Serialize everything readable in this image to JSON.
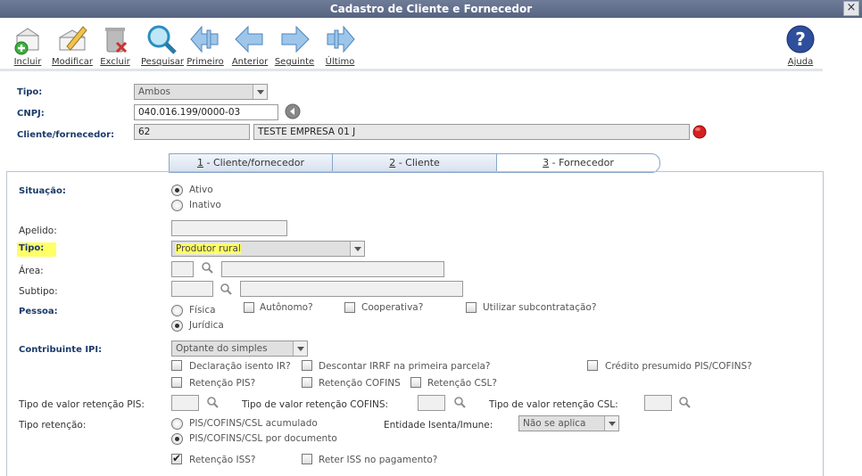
{
  "window": {
    "title": "Cadastro de Cliente e Fornecedor",
    "close": "×"
  },
  "toolbar": {
    "incluir": "Incluir",
    "modificar": "Modificar",
    "excluir": "Excluir",
    "pesquisar": "Pesquisar",
    "primeiro": "Primeiro",
    "anterior": "Anterior",
    "seguinte": "Seguinte",
    "ultimo": "Último",
    "ajuda": "Ajuda"
  },
  "header": {
    "tipo_label": "Tipo:",
    "tipo_value": "Ambos",
    "cnpj_label": "CNPJ:",
    "cnpj_value": "040.016.199/0000-03",
    "cliente_label": "Cliente/fornecedor:",
    "cliente_code": "62",
    "cliente_name": "TESTE EMPRESA 01 J"
  },
  "tabs": [
    {
      "num": "1",
      "label": " - Cliente/fornecedor"
    },
    {
      "num": "2",
      "label": " - Cliente"
    },
    {
      "num": "3",
      "label": " - Fornecedor"
    }
  ],
  "form": {
    "situacao_label": "Situação:",
    "situacao_ativo": "Ativo",
    "situacao_inativo": "Inativo",
    "apelido_label": "Apelido:",
    "tipo_label": "Tipo:",
    "tipo_value": "Produtor rural",
    "area_label": "Área:",
    "subtipo_label": "Subtipo:",
    "pessoa_label": "Pessoa:",
    "pessoa_fisica": "Física",
    "pessoa_juridica": "Jurídica",
    "autonomo": "Autônomo?",
    "cooperativa": "Cooperativa?",
    "subcontratacao": "Utilizar subcontratação?",
    "contribuinte_label": "Contribuinte IPI:",
    "contribuinte_value": "Optante do simples",
    "decl_isento": "Declaração isento IR?",
    "descontar_irrf": "Descontar IRRF na primeira parcela?",
    "credito_presumido": "Crédito presumido PIS/COFINS?",
    "retencao_pis": "Retenção PIS?",
    "retencao_cofins": "Retenção COFINS",
    "retencao_csl": "Retenção CSL?",
    "tipo_valor_pis": "Tipo de valor retenção PIS:",
    "tipo_valor_cofins": "Tipo de valor retenção COFINS:",
    "tipo_valor_csl": "Tipo de valor retenção CSL:",
    "tipo_retencao_label": "Tipo retenção:",
    "tipo_ret_acumulado": "PIS/COFINS/CSL acumulado",
    "tipo_ret_documento": "PIS/COFINS/CSL por documento",
    "entidade_label": "Entidade Isenta/Imune:",
    "entidade_value": "Não se aplica",
    "retencao_iss": "Retenção ISS?",
    "reter_iss": "Reter ISS no pagamento?"
  }
}
